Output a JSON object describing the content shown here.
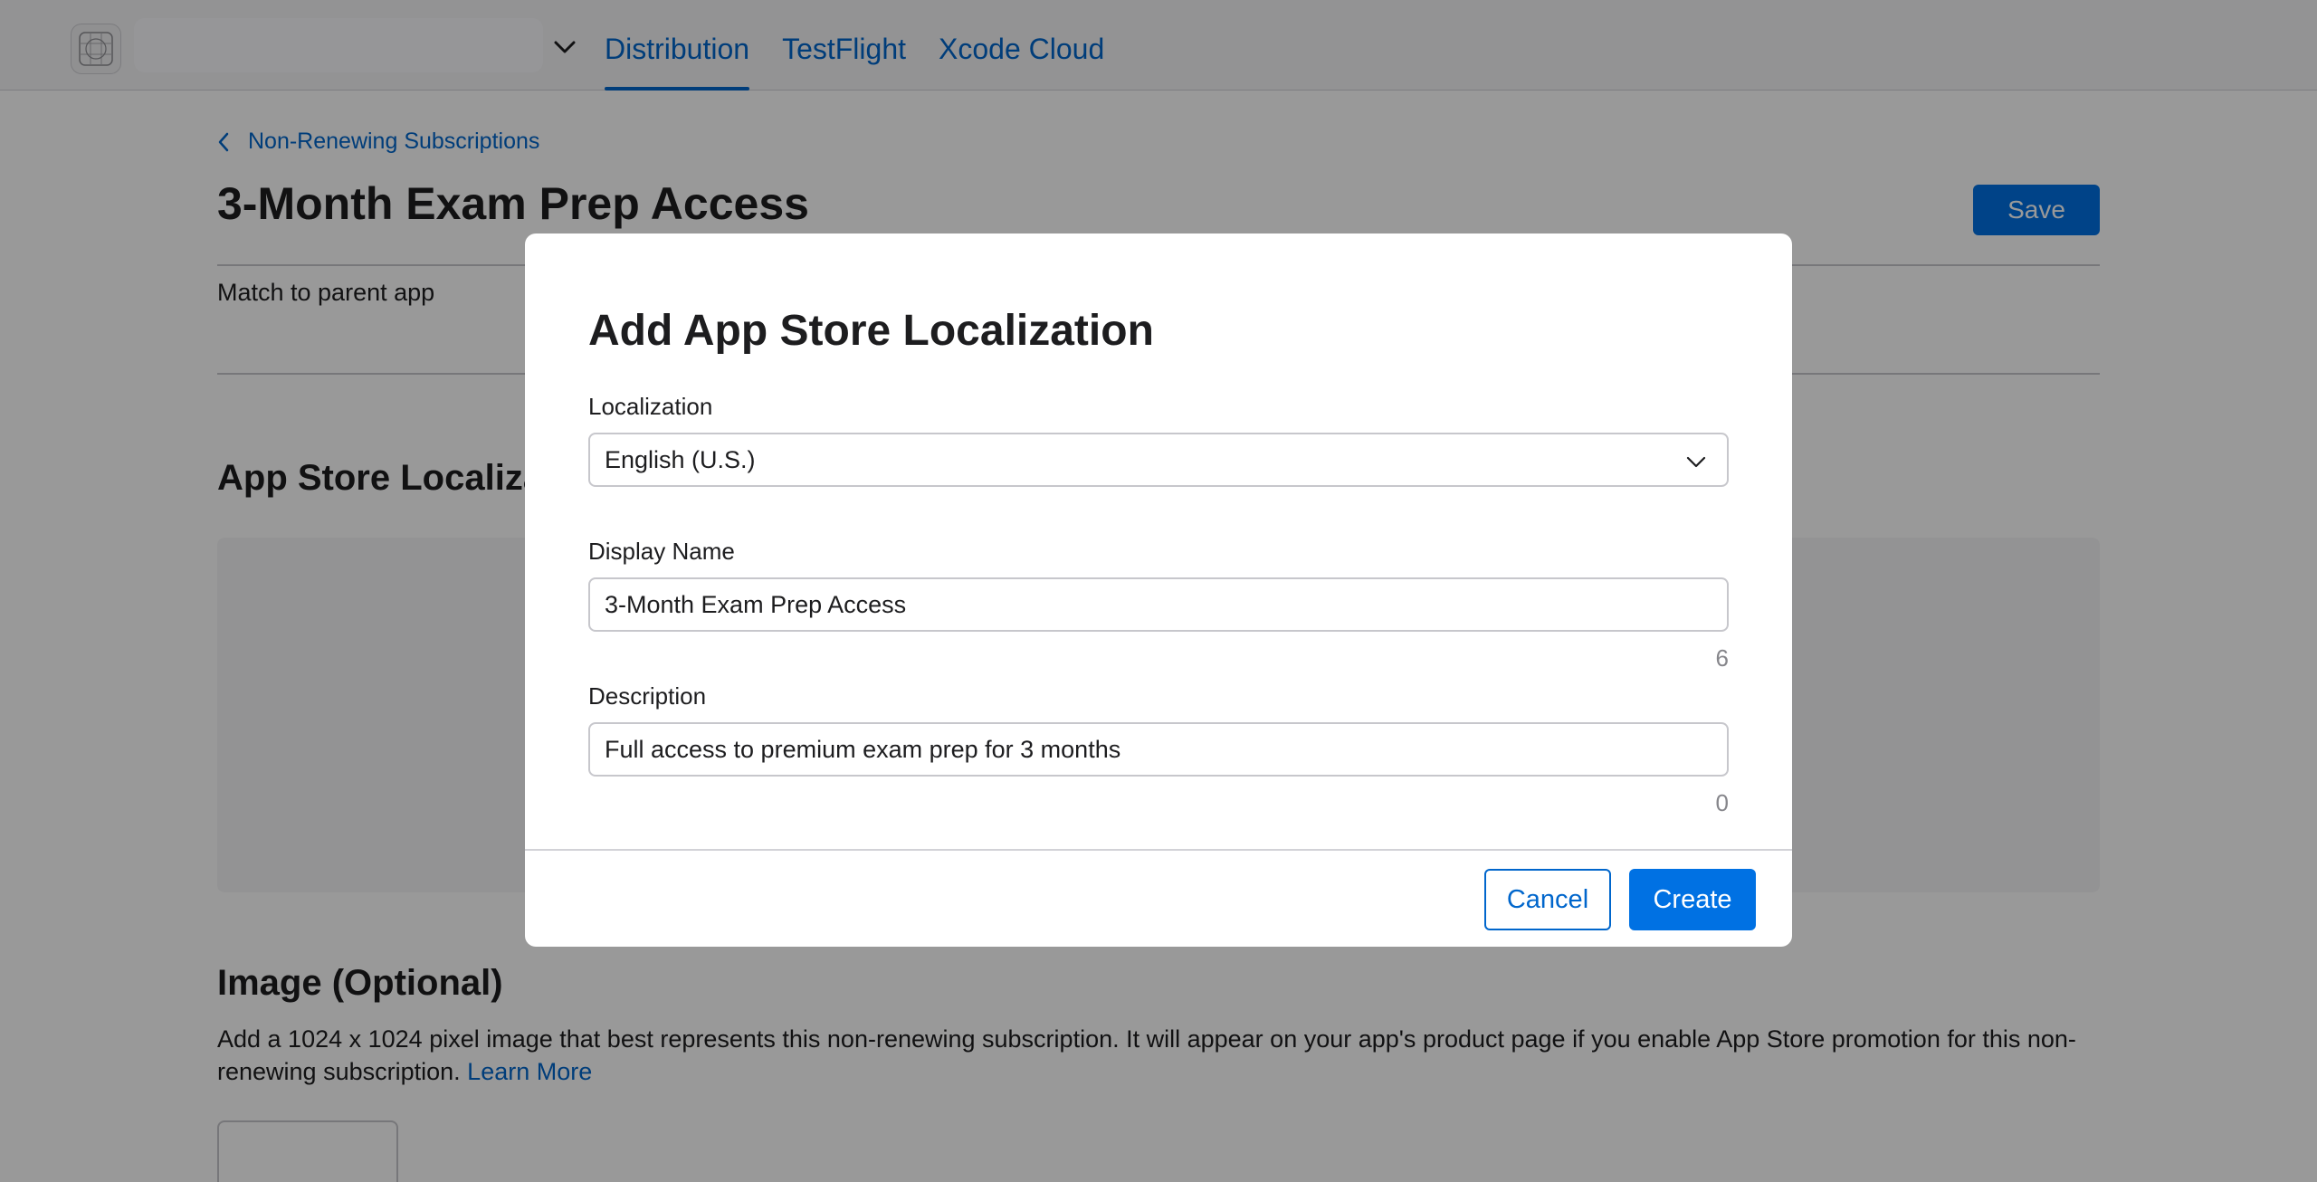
{
  "nav": {
    "tabs": [
      {
        "label": "Distribution",
        "active": true
      },
      {
        "label": "TestFlight",
        "active": false
      },
      {
        "label": "Xcode Cloud",
        "active": false
      }
    ],
    "app_icon": "app-icon",
    "app_switcher_icon": "chevron-down-icon"
  },
  "page": {
    "breadcrumb": "Non-Renewing Subscriptions",
    "title": "3-Month Exam Prep Access",
    "save_label": "Save",
    "match_text": "Match to parent app",
    "localization_section_title": "App Store Localiza",
    "image_section": {
      "title": "Image (Optional)",
      "description": "Add a 1024 x 1024 pixel image that best represents this non-renewing subscription. It will appear on your app's product page if you enable App Store promotion for this non-renewing subscription.",
      "learn_more": "Learn More"
    }
  },
  "modal": {
    "title": "Add App Store Localization",
    "localization": {
      "label": "Localization",
      "value": "English (U.S.)"
    },
    "display_name": {
      "label": "Display Name",
      "value": "3-Month Exam Prep Access",
      "counter": "6"
    },
    "description": {
      "label": "Description",
      "value": "Full access to premium exam prep for 3 months",
      "counter": "0"
    },
    "cancel_label": "Cancel",
    "create_label": "Create"
  },
  "colors": {
    "accent": "#0071e3",
    "link": "#0066cc",
    "overlay": "rgba(0,0,0,0.40)"
  }
}
